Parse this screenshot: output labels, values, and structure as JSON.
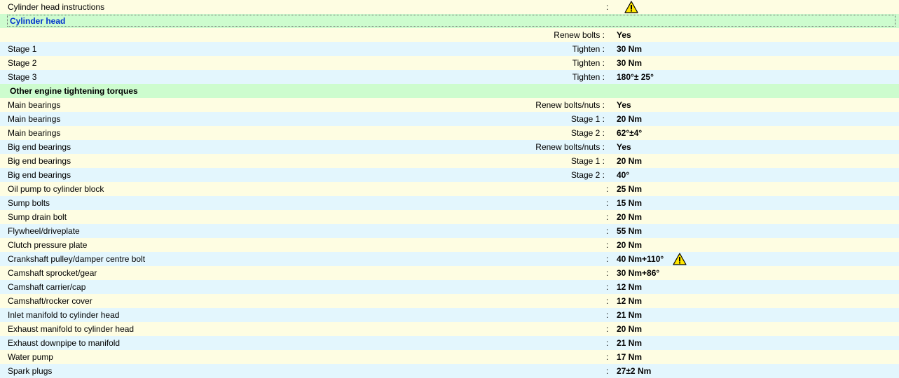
{
  "rows": [
    {
      "type": "data",
      "shade": "a",
      "label": "Cylinder head instructions",
      "sublabel": "",
      "colon": ":",
      "value": "",
      "warning": true,
      "warning_offset": "head"
    },
    {
      "type": "section",
      "selected": true,
      "title": "Cylinder head"
    },
    {
      "type": "data",
      "shade": "a",
      "label": "",
      "sublabel": "Renew bolts :",
      "colon": "",
      "value": "Yes"
    },
    {
      "type": "data",
      "shade": "b",
      "label": "Stage 1",
      "sublabel": "Tighten :",
      "colon": "",
      "value": "30 Nm"
    },
    {
      "type": "data",
      "shade": "a",
      "label": "Stage 2",
      "sublabel": "Tighten :",
      "colon": "",
      "value": "30 Nm"
    },
    {
      "type": "data",
      "shade": "b",
      "label": "Stage 3",
      "sublabel": "Tighten :",
      "colon": "",
      "value": "180°± 25°"
    },
    {
      "type": "section",
      "selected": false,
      "title": "Other engine tightening torques"
    },
    {
      "type": "data",
      "shade": "a",
      "label": "Main bearings",
      "sublabel": "Renew bolts/nuts :",
      "colon": "",
      "value": "Yes"
    },
    {
      "type": "data",
      "shade": "b",
      "label": "Main bearings",
      "sublabel": "Stage 1 :",
      "colon": "",
      "value": "20 Nm"
    },
    {
      "type": "data",
      "shade": "a",
      "label": "Main bearings",
      "sublabel": "Stage 2 :",
      "colon": "",
      "value": "62°±4°"
    },
    {
      "type": "data",
      "shade": "b",
      "label": "Big end bearings",
      "sublabel": "Renew bolts/nuts :",
      "colon": "",
      "value": "Yes"
    },
    {
      "type": "data",
      "shade": "a",
      "label": "Big end bearings",
      "sublabel": "Stage 1 :",
      "colon": "",
      "value": "20 Nm"
    },
    {
      "type": "data",
      "shade": "b",
      "label": "Big end bearings",
      "sublabel": "Stage 2 :",
      "colon": "",
      "value": "40°"
    },
    {
      "type": "data",
      "shade": "a",
      "label": "Oil pump to cylinder block",
      "sublabel": "",
      "colon": ":",
      "value": "25 Nm"
    },
    {
      "type": "data",
      "shade": "b",
      "label": "Sump bolts",
      "sublabel": "",
      "colon": ":",
      "value": "15 Nm"
    },
    {
      "type": "data",
      "shade": "a",
      "label": "Sump drain bolt",
      "sublabel": "",
      "colon": ":",
      "value": "20 Nm"
    },
    {
      "type": "data",
      "shade": "b",
      "label": "Flywheel/driveplate",
      "sublabel": "",
      "colon": ":",
      "value": "55 Nm"
    },
    {
      "type": "data",
      "shade": "a",
      "label": "Clutch pressure plate",
      "sublabel": "",
      "colon": ":",
      "value": "20 Nm"
    },
    {
      "type": "data",
      "shade": "b",
      "label": "Crankshaft pulley/damper centre bolt",
      "sublabel": "",
      "colon": ":",
      "value": "40 Nm+110°",
      "warning": true,
      "warning_offset": "value"
    },
    {
      "type": "data",
      "shade": "a",
      "label": "Camshaft sprocket/gear",
      "sublabel": "",
      "colon": ":",
      "value": "30 Nm+86°"
    },
    {
      "type": "data",
      "shade": "b",
      "label": "Camshaft carrier/cap",
      "sublabel": "",
      "colon": ":",
      "value": "12 Nm"
    },
    {
      "type": "data",
      "shade": "a",
      "label": "Camshaft/rocker cover",
      "sublabel": "",
      "colon": ":",
      "value": "12 Nm"
    },
    {
      "type": "data",
      "shade": "b",
      "label": "Inlet manifold to cylinder head",
      "sublabel": "",
      "colon": ":",
      "value": "21 Nm"
    },
    {
      "type": "data",
      "shade": "a",
      "label": "Exhaust manifold to cylinder head",
      "sublabel": "",
      "colon": ":",
      "value": "20 Nm"
    },
    {
      "type": "data",
      "shade": "b",
      "label": "Exhaust downpipe to manifold",
      "sublabel": "",
      "colon": ":",
      "value": "21 Nm"
    },
    {
      "type": "data",
      "shade": "a",
      "label": "Water pump",
      "sublabel": "",
      "colon": ":",
      "value": "17 Nm"
    },
    {
      "type": "data",
      "shade": "b",
      "label": "Spark plugs",
      "sublabel": "",
      "colon": ":",
      "value": "27±2 Nm"
    }
  ],
  "icons": {
    "warning": "warning-triangle-icon"
  },
  "colors": {
    "row_a": "#fefde2",
    "row_b": "#e3f6fd",
    "section": "#cdfcce",
    "selected_section_text": "#0033cc",
    "warning_fill": "#ffe600"
  }
}
